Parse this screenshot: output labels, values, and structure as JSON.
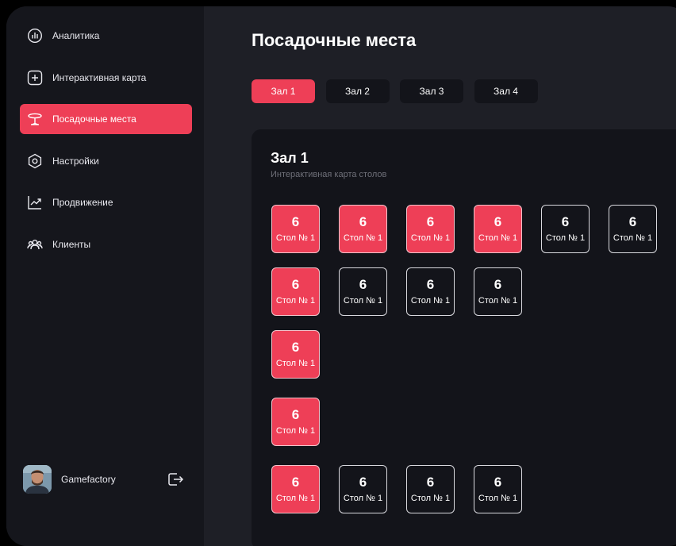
{
  "sidebar": {
    "items": [
      {
        "label": "Аналитика",
        "icon": "bar-chart-icon",
        "active": false
      },
      {
        "label": "Интерактивная карта",
        "icon": "plus-square-icon",
        "active": false
      },
      {
        "label": "Посадочные места",
        "icon": "table-icon",
        "active": true
      },
      {
        "label": "Настройки",
        "icon": "hexagon-settings-icon",
        "active": false
      },
      {
        "label": "Продвижение",
        "icon": "trend-chart-icon",
        "active": false
      },
      {
        "label": "Клиенты",
        "icon": "users-icon",
        "active": false
      }
    ],
    "user": {
      "name": "Gamefactory",
      "logout_icon": "logout-icon"
    }
  },
  "main": {
    "title": "Посадочные места",
    "tabs": [
      {
        "label": "Зал 1",
        "active": true
      },
      {
        "label": "Зал 2",
        "active": false
      },
      {
        "label": "Зал 3",
        "active": false
      },
      {
        "label": "Зал 4",
        "active": false
      }
    ],
    "hall": {
      "title": "Зал 1",
      "subtitle": "Интерактивная карта столов",
      "rows": [
        [
          {
            "seats": "6",
            "name": "Стол № 1",
            "occupied": true
          },
          {
            "seats": "6",
            "name": "Стол № 1",
            "occupied": true
          },
          {
            "seats": "6",
            "name": "Стол № 1",
            "occupied": true
          },
          {
            "seats": "6",
            "name": "Стол № 1",
            "occupied": true
          },
          {
            "seats": "6",
            "name": "Стол № 1",
            "occupied": false
          },
          {
            "seats": "6",
            "name": "Стол № 1",
            "occupied": false
          }
        ],
        [
          {
            "seats": "6",
            "name": "Стол № 1",
            "occupied": true
          },
          {
            "seats": "6",
            "name": "Стол № 1",
            "occupied": false
          },
          {
            "seats": "6",
            "name": "Стол № 1",
            "occupied": false
          },
          {
            "seats": "6",
            "name": "Стол № 1",
            "occupied": false
          }
        ],
        [
          {
            "seats": "6",
            "name": "Стол № 1",
            "occupied": true
          }
        ],
        [
          {
            "seats": "6",
            "name": "Стол № 1",
            "occupied": true
          }
        ],
        [
          {
            "seats": "6",
            "name": "Стол № 1",
            "occupied": true
          },
          {
            "seats": "6",
            "name": "Стол № 1",
            "occupied": false
          },
          {
            "seats": "6",
            "name": "Стол № 1",
            "occupied": false
          },
          {
            "seats": "6",
            "name": "Стол № 1",
            "occupied": false
          }
        ]
      ]
    }
  },
  "colors": {
    "accent": "#ee3f57",
    "sidebar": "#15161c",
    "background": "#1e1f26",
    "panel": "#13141a"
  }
}
